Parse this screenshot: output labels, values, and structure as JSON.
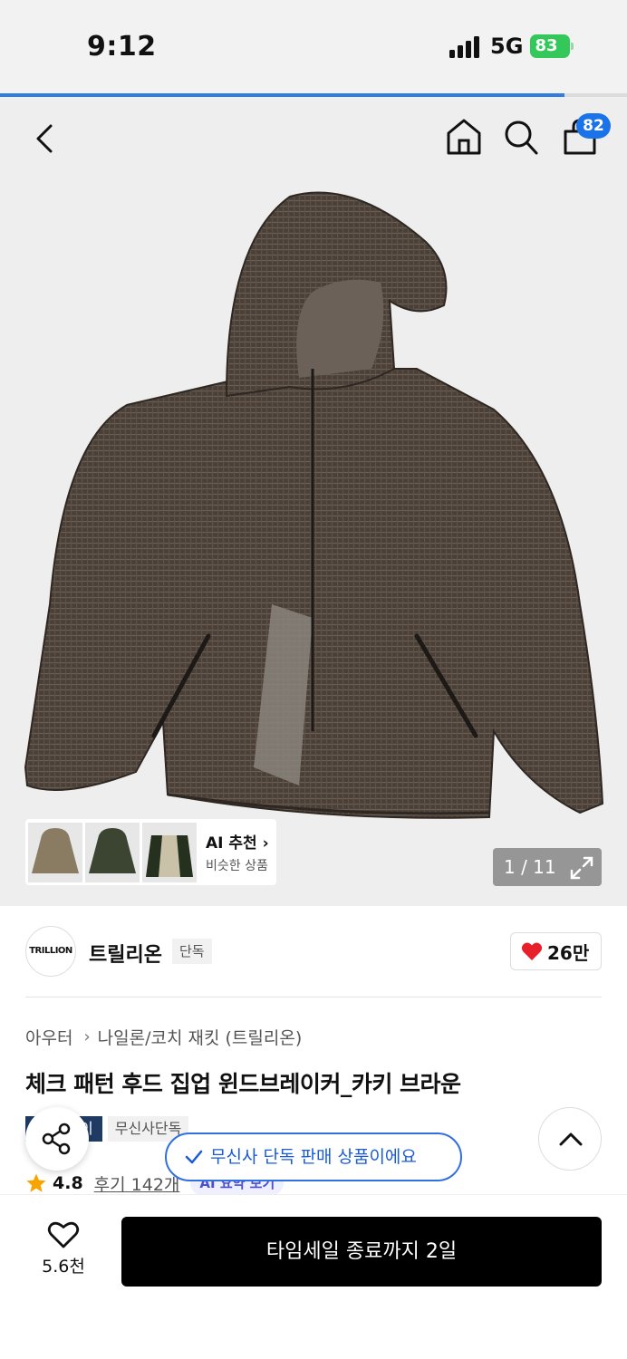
{
  "status_bar": {
    "time": "9:12",
    "network": "5G",
    "battery": "83"
  },
  "gallery": {
    "progress": 0.9,
    "counter": "1 / 11"
  },
  "header": {
    "cart_count": "82"
  },
  "ai_recommend": {
    "title": "AI 추천",
    "subtitle": "비슷한 상품"
  },
  "brand": {
    "logo_text": "TRILLION",
    "name": "트릴리온",
    "tag": "단독",
    "likes": "26만"
  },
  "breadcrumb": {
    "category": "아우터",
    "subcategory": "나일론/코치 재킷 (트릴리온)"
  },
  "product": {
    "title": "체크 패턴 후드 집업 윈드브레이커_카키 브라운"
  },
  "tags": {
    "pay": "이",
    "exclusive": "무신사단독"
  },
  "toast": {
    "message": "무신사 단독 판매 상품이에요"
  },
  "rating": {
    "score": "4.8",
    "reviews": "후기 142개",
    "ai_summary": "AI 요약 보기"
  },
  "bottom_bar": {
    "wish_count": "5.6천",
    "cta_label": "타임세일 종료까지 2일"
  },
  "colors": {
    "accent_blue": "#2f7de1",
    "cta": "#000000",
    "heart": "#e8202a",
    "battery": "#34c759"
  }
}
